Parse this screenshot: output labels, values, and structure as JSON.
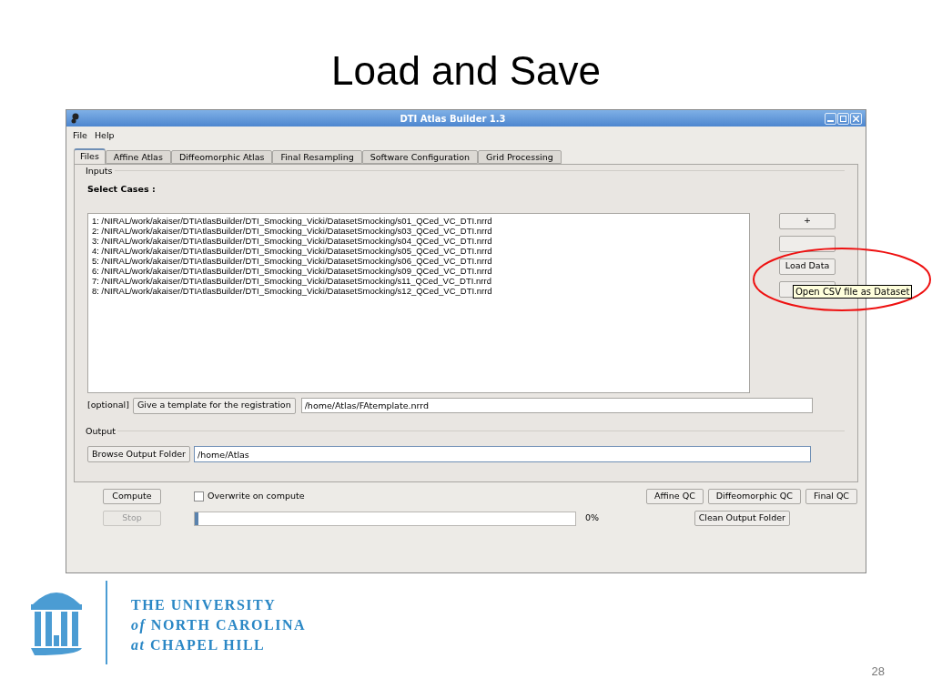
{
  "slide": {
    "title": "Load and Save",
    "page_number": "28"
  },
  "window": {
    "title": "DTI Atlas Builder 1.3"
  },
  "menu": [
    "File",
    "Help"
  ],
  "tabs": [
    {
      "label": "Files",
      "selected": true
    },
    {
      "label": "Affine Atlas",
      "selected": false
    },
    {
      "label": "Diffeomorphic Atlas",
      "selected": false
    },
    {
      "label": "Final Resampling",
      "selected": false
    },
    {
      "label": "Software Configuration",
      "selected": false
    },
    {
      "label": "Grid Processing",
      "selected": false
    }
  ],
  "inputs": {
    "group_title": "Inputs",
    "select_label": "Select Cases :",
    "cases": [
      "1: /NIRAL/work/akaiser/DTIAtlasBuilder/DTI_Smocking_Vicki/DatasetSmocking/s01_QCed_VC_DTI.nrrd",
      "2: /NIRAL/work/akaiser/DTIAtlasBuilder/DTI_Smocking_Vicki/DatasetSmocking/s03_QCed_VC_DTI.nrrd",
      "3: /NIRAL/work/akaiser/DTIAtlasBuilder/DTI_Smocking_Vicki/DatasetSmocking/s04_QCed_VC_DTI.nrrd",
      "4: /NIRAL/work/akaiser/DTIAtlasBuilder/DTI_Smocking_Vicki/DatasetSmocking/s05_QCed_VC_DTI.nrrd",
      "5: /NIRAL/work/akaiser/DTIAtlasBuilder/DTI_Smocking_Vicki/DatasetSmocking/s06_QCed_VC_DTI.nrrd",
      "6: /NIRAL/work/akaiser/DTIAtlasBuilder/DTI_Smocking_Vicki/DatasetSmocking/s09_QCed_VC_DTI.nrrd",
      "7: /NIRAL/work/akaiser/DTIAtlasBuilder/DTI_Smocking_Vicki/DatasetSmocking/s11_QCed_VC_DTI.nrrd",
      "8: /NIRAL/work/akaiser/DTIAtlasBuilder/DTI_Smocking_Vicki/DatasetSmocking/s12_QCed_VC_DTI.nrrd"
    ],
    "add_button": "+",
    "load_button": "Load Data",
    "tooltip": "Open CSV file as Dataset"
  },
  "template": {
    "optional_label": "[optional]",
    "button": "Give a template for the registration",
    "value": "/home/Atlas/FAtemplate.nrrd"
  },
  "output": {
    "group_title": "Output",
    "button": "Browse Output Folder",
    "value": "/home/Atlas"
  },
  "controls": {
    "compute": "Compute",
    "stop": {
      "label": "Stop",
      "disabled": true
    },
    "overwrite": {
      "label": "Overwrite on compute",
      "checked": false
    },
    "progress": {
      "level": 0.01,
      "reading": "0%"
    },
    "qc_buttons": [
      "Affine QC",
      "Diffeomorphic QC",
      "Final QC"
    ],
    "clean": "Clean Output Folder"
  },
  "logo": {
    "lines": [
      "THE UNIVERSITY",
      "*of* NORTH CAROLINA",
      "*at* CHAPEL HILL"
    ]
  }
}
